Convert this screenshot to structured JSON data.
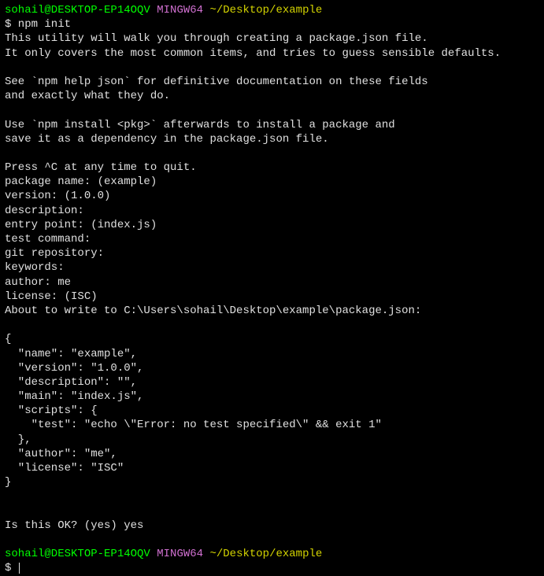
{
  "prompt1": {
    "user": "sohail@DESKTOP-EP14OQV",
    "mingw": "MINGW64",
    "path": "~/Desktop/example"
  },
  "cmd1": "$ npm init",
  "intro": {
    "l1": "This utility will walk you through creating a package.json file.",
    "l2": "It only covers the most common items, and tries to guess sensible defaults.",
    "l3": "See `npm help json` for definitive documentation on these fields",
    "l4": "and exactly what they do.",
    "l5": "Use `npm install <pkg>` afterwards to install a package and",
    "l6": "save it as a dependency in the package.json file.",
    "l7": "Press ^C at any time to quit."
  },
  "prompts": {
    "p1": "package name: (example)",
    "p2": "version: (1.0.0)",
    "p3": "description:",
    "p4": "entry point: (index.js)",
    "p5": "test command:",
    "p6": "git repository:",
    "p7": "keywords:",
    "p8": "author: me",
    "p9": "license: (ISC)"
  },
  "about": "About to write to C:\\Users\\sohail\\Desktop\\example\\package.json:",
  "json": {
    "l1": "{",
    "l2": "  \"name\": \"example\",",
    "l3": "  \"version\": \"1.0.0\",",
    "l4": "  \"description\": \"\",",
    "l5": "  \"main\": \"index.js\",",
    "l6": "  \"scripts\": {",
    "l7": "    \"test\": \"echo \\\"Error: no test specified\\\" && exit 1\"",
    "l8": "  },",
    "l9": "  \"author\": \"me\",",
    "l10": "  \"license\": \"ISC\"",
    "l11": "}"
  },
  "confirm": "Is this OK? (yes) yes",
  "prompt2": {
    "user": "sohail@DESKTOP-EP14OQV",
    "mingw": "MINGW64",
    "path": "~/Desktop/example"
  },
  "cmd2": "$ "
}
